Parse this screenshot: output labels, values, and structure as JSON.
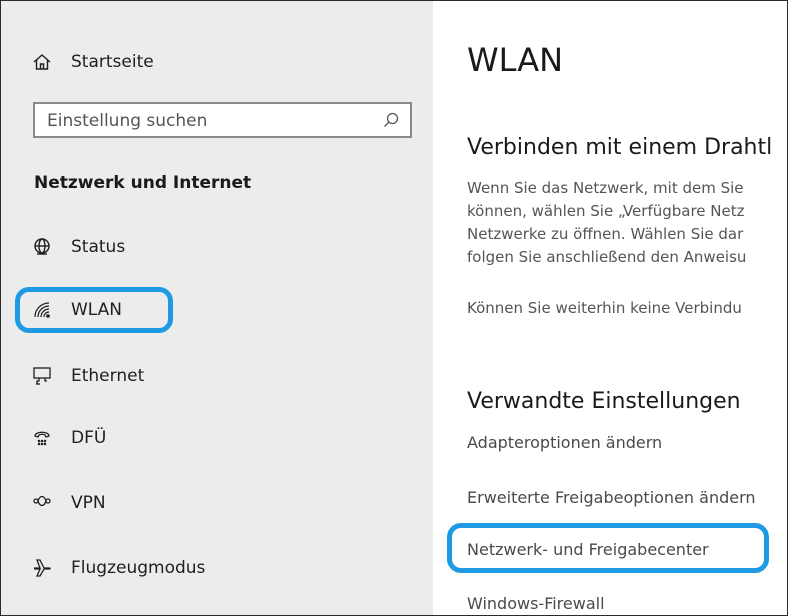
{
  "sidebar": {
    "home_label": "Startseite",
    "search": {
      "placeholder": "Einstellung suchen"
    },
    "section_title": "Netzwerk und Internet",
    "items": [
      {
        "label": "Status",
        "icon": "globe-icon"
      },
      {
        "label": "WLAN",
        "icon": "wifi-icon",
        "selected": true
      },
      {
        "label": "Ethernet",
        "icon": "ethernet-icon"
      },
      {
        "label": "DFÜ",
        "icon": "dialup-icon"
      },
      {
        "label": "VPN",
        "icon": "vpn-icon"
      },
      {
        "label": "Flugzeugmodus",
        "icon": "airplane-icon"
      }
    ]
  },
  "main": {
    "title": "WLAN",
    "connect_heading": "Verbinden mit einem Drahtl",
    "connect_text": [
      "Wenn Sie das Netzwerk, mit dem Sie",
      "können, wählen Sie „Verfügbare Netz",
      "Netzwerke zu öffnen. Wählen Sie dar",
      "folgen Sie anschließend den Anweisu"
    ],
    "connect_link": "Können Sie weiterhin keine Verbindu",
    "related_heading": "Verwandte Einstellungen",
    "related_links": [
      "Adapteroptionen ändern",
      "Erweiterte Freigabeoptionen ändern",
      "Netzwerk- und Freigabecenter",
      "Windows-Firewall"
    ]
  },
  "colors": {
    "highlight": "#1d9ae3",
    "sidebar_bg": "#ececec",
    "link": "#4a6fa0"
  }
}
